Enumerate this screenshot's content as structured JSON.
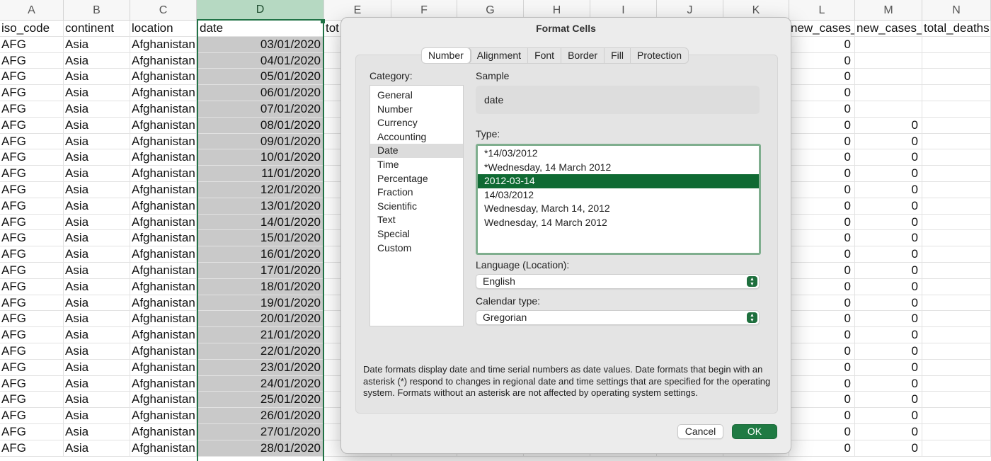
{
  "sheet": {
    "columns": [
      "A",
      "B",
      "C",
      "D",
      "E",
      "F",
      "G",
      "H",
      "I",
      "J",
      "K",
      "L",
      "M",
      "N"
    ],
    "selected_column": "D",
    "headers": [
      "iso_code",
      "continent",
      "location",
      "date",
      "tot",
      "",
      "",
      "",
      "",
      "",
      "",
      "new_cases_p",
      "new_cases_s",
      "total_deaths"
    ],
    "rows": [
      {
        "iso": "AFG",
        "cont": "Asia",
        "loc": "Afghanistan",
        "date": "03/01/2020",
        "l": "0",
        "m": ""
      },
      {
        "iso": "AFG",
        "cont": "Asia",
        "loc": "Afghanistan",
        "date": "04/01/2020",
        "l": "0",
        "m": ""
      },
      {
        "iso": "AFG",
        "cont": "Asia",
        "loc": "Afghanistan",
        "date": "05/01/2020",
        "l": "0",
        "m": ""
      },
      {
        "iso": "AFG",
        "cont": "Asia",
        "loc": "Afghanistan",
        "date": "06/01/2020",
        "l": "0",
        "m": ""
      },
      {
        "iso": "AFG",
        "cont": "Asia",
        "loc": "Afghanistan",
        "date": "07/01/2020",
        "l": "0",
        "m": ""
      },
      {
        "iso": "AFG",
        "cont": "Asia",
        "loc": "Afghanistan",
        "date": "08/01/2020",
        "l": "0",
        "m": "0"
      },
      {
        "iso": "AFG",
        "cont": "Asia",
        "loc": "Afghanistan",
        "date": "09/01/2020",
        "l": "0",
        "m": "0"
      },
      {
        "iso": "AFG",
        "cont": "Asia",
        "loc": "Afghanistan",
        "date": "10/01/2020",
        "l": "0",
        "m": "0"
      },
      {
        "iso": "AFG",
        "cont": "Asia",
        "loc": "Afghanistan",
        "date": "11/01/2020",
        "l": "0",
        "m": "0"
      },
      {
        "iso": "AFG",
        "cont": "Asia",
        "loc": "Afghanistan",
        "date": "12/01/2020",
        "l": "0",
        "m": "0"
      },
      {
        "iso": "AFG",
        "cont": "Asia",
        "loc": "Afghanistan",
        "date": "13/01/2020",
        "l": "0",
        "m": "0"
      },
      {
        "iso": "AFG",
        "cont": "Asia",
        "loc": "Afghanistan",
        "date": "14/01/2020",
        "l": "0",
        "m": "0"
      },
      {
        "iso": "AFG",
        "cont": "Asia",
        "loc": "Afghanistan",
        "date": "15/01/2020",
        "l": "0",
        "m": "0"
      },
      {
        "iso": "AFG",
        "cont": "Asia",
        "loc": "Afghanistan",
        "date": "16/01/2020",
        "l": "0",
        "m": "0"
      },
      {
        "iso": "AFG",
        "cont": "Asia",
        "loc": "Afghanistan",
        "date": "17/01/2020",
        "l": "0",
        "m": "0"
      },
      {
        "iso": "AFG",
        "cont": "Asia",
        "loc": "Afghanistan",
        "date": "18/01/2020",
        "l": "0",
        "m": "0"
      },
      {
        "iso": "AFG",
        "cont": "Asia",
        "loc": "Afghanistan",
        "date": "19/01/2020",
        "l": "0",
        "m": "0"
      },
      {
        "iso": "AFG",
        "cont": "Asia",
        "loc": "Afghanistan",
        "date": "20/01/2020",
        "l": "0",
        "m": "0"
      },
      {
        "iso": "AFG",
        "cont": "Asia",
        "loc": "Afghanistan",
        "date": "21/01/2020",
        "l": "0",
        "m": "0"
      },
      {
        "iso": "AFG",
        "cont": "Asia",
        "loc": "Afghanistan",
        "date": "22/01/2020",
        "l": "0",
        "m": "0"
      },
      {
        "iso": "AFG",
        "cont": "Asia",
        "loc": "Afghanistan",
        "date": "23/01/2020",
        "l": "0",
        "m": "0"
      },
      {
        "iso": "AFG",
        "cont": "Asia",
        "loc": "Afghanistan",
        "date": "24/01/2020",
        "l": "0",
        "m": "0"
      },
      {
        "iso": "AFG",
        "cont": "Asia",
        "loc": "Afghanistan",
        "date": "25/01/2020",
        "l": "0",
        "m": "0"
      },
      {
        "iso": "AFG",
        "cont": "Asia",
        "loc": "Afghanistan",
        "date": "26/01/2020",
        "l": "0",
        "m": "0"
      },
      {
        "iso": "AFG",
        "cont": "Asia",
        "loc": "Afghanistan",
        "date": "27/01/2020",
        "l": "0",
        "m": "0"
      },
      {
        "iso": "AFG",
        "cont": "Asia",
        "loc": "Afghanistan",
        "date": "28/01/2020",
        "l": "0",
        "m": "0"
      }
    ]
  },
  "dialog": {
    "title": "Format Cells",
    "tabs": [
      "Number",
      "Alignment",
      "Font",
      "Border",
      "Fill",
      "Protection"
    ],
    "active_tab": "Number",
    "category_label": "Category:",
    "categories": [
      "General",
      "Number",
      "Currency",
      "Accounting",
      "Date",
      "Time",
      "Percentage",
      "Fraction",
      "Scientific",
      "Text",
      "Special",
      "Custom"
    ],
    "selected_category": "Date",
    "sample_label": "Sample",
    "sample_value": "date",
    "type_label": "Type:",
    "types": [
      "*14/03/2012",
      "*Wednesday, 14 March 2012",
      "2012-03-14",
      "14/03/2012",
      "Wednesday, March 14, 2012",
      "Wednesday, 14 March 2012"
    ],
    "selected_type": "2012-03-14",
    "language_label": "Language (Location):",
    "language_value": "English",
    "calendar_label": "Calendar type:",
    "calendar_value": "Gregorian",
    "description": "Date formats display date and time serial numbers as date values.  Date formats that begin with an asterisk (*) respond to changes in regional date and time settings that are specified for the operating system. Formats without an asterisk are not affected by operating system settings.",
    "cancel_label": "Cancel",
    "ok_label": "OK"
  },
  "colors": {
    "accent_green": "#217346",
    "ok_button": "#1f7a43",
    "type_selected": "#0f6a33",
    "selected_column_header": "#b6d9c2",
    "selected_cells": "#c9c9c9"
  },
  "icons": {
    "select_arrows": "up-down-chevron-icon"
  }
}
